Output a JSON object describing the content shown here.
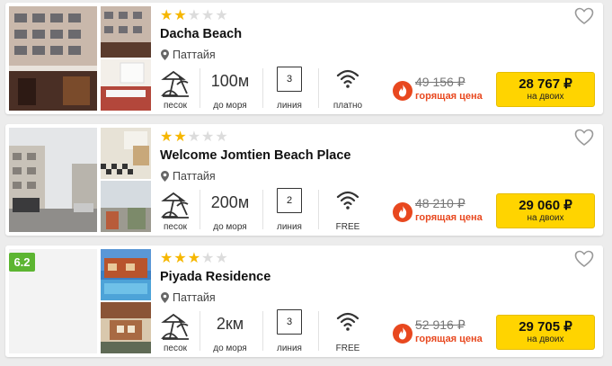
{
  "hotels": [
    {
      "name": "Dacha Beach",
      "stars": 2,
      "max_stars": 5,
      "city": "Паттайя",
      "beach_label": "песок",
      "distance": "100м",
      "distance_label": "до моря",
      "line": "3",
      "line_label": "линия",
      "wifi_label": "платно",
      "old_price": "49 156 ₽",
      "hot_label": "горящая цена",
      "price": "28 767 ₽",
      "price_sub": "на двоих"
    },
    {
      "name": "Welcome Jomtien Beach Place",
      "stars": 2,
      "max_stars": 5,
      "city": "Паттайя",
      "beach_label": "песок",
      "distance": "200м",
      "distance_label": "до моря",
      "line": "2",
      "line_label": "линия",
      "wifi_label": "FREE",
      "old_price": "48 210 ₽",
      "hot_label": "горящая цена",
      "price": "29 060 ₽",
      "price_sub": "на двоих"
    },
    {
      "name": "Piyada Residence",
      "rating": "6.2",
      "stars": 3,
      "max_stars": 5,
      "city": "Паттайя",
      "beach_label": "песок",
      "distance": "2км",
      "distance_label": "до моря",
      "line": "3",
      "line_label": "линия",
      "wifi_label": "FREE",
      "old_price": "52 916 ₽",
      "hot_label": "горящая цена",
      "price": "29 705 ₽",
      "price_sub": "на двоих"
    }
  ],
  "colors": {
    "star_on": "#f6b700",
    "star_off": "#dcdcdc",
    "price_button": "#ffd400",
    "hot": "#e8481f",
    "rating_badge": "#5cb531"
  },
  "icons": [
    "heart-outline-icon",
    "map-pin-icon",
    "beach-umbrella-icon",
    "wifi-icon",
    "fire-icon",
    "star-icon"
  ]
}
